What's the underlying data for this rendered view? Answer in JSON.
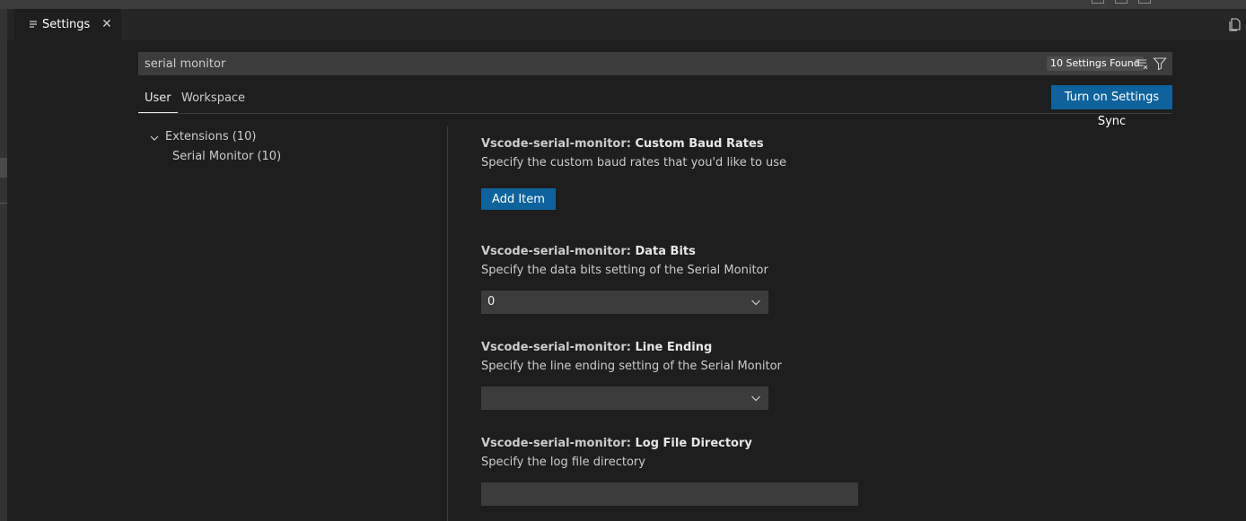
{
  "editor": {
    "tab_label": "Settings",
    "tab_close": "✕"
  },
  "search": {
    "value": "serial monitor",
    "results_count": "10 Settings Found"
  },
  "scope_tabs": [
    {
      "label": "User",
      "active": true
    },
    {
      "label": "Workspace",
      "active": false
    }
  ],
  "sync_button": "Turn on Settings Sync",
  "toc": {
    "extensions": "Extensions (10)",
    "serial_monitor": "Serial Monitor (10)"
  },
  "settings": [
    {
      "category": "Vscode-serial-monitor: ",
      "name": "Custom Baud Rates",
      "description": "Specify the custom baud rates that you'd like to use",
      "control": "Add Item"
    },
    {
      "category": "Vscode-serial-monitor: ",
      "name": "Data Bits",
      "description": "Specify the data bits setting of the Serial Monitor",
      "value": "0"
    },
    {
      "category": "Vscode-serial-monitor: ",
      "name": "Line Ending",
      "description": "Specify the line ending setting of the Serial Monitor",
      "value": ""
    },
    {
      "category": "Vscode-serial-monitor: ",
      "name": "Log File Directory",
      "description": "Specify the log file directory",
      "value": ""
    }
  ],
  "colors": {
    "editor_bg": "#1e1e1e",
    "accent_button": "#0e639c",
    "input_bg": "#3c3c3c"
  }
}
